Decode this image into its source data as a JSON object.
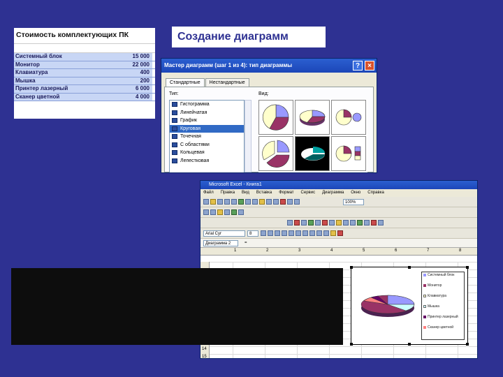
{
  "slide_title": "Создание диаграмм",
  "price_table": {
    "title": "Стоимость комплектующих ПК",
    "rows": [
      {
        "name": "Системный блок",
        "value": "15 000"
      },
      {
        "name": "Монитор",
        "value": "22 000"
      },
      {
        "name": "Клавиатура",
        "value": "400"
      },
      {
        "name": "Мышка",
        "value": "200"
      },
      {
        "name": "Принтер лазерный",
        "value": "6 000"
      },
      {
        "name": "Сканер цветной",
        "value": "4 000"
      }
    ]
  },
  "wizard": {
    "title": "Мастер диаграмм (шаг 1 из 4): тип диаграммы",
    "help": "?",
    "close": "×",
    "tabs": [
      "Стандартные",
      "Нестандартные"
    ],
    "type_label": "Тип:",
    "view_label": "Вид:",
    "types": [
      "Гистограмма",
      "Линейчатая",
      "График",
      "Круговая",
      "Точечная",
      "С областями",
      "Кольцевая",
      "Лепестковая"
    ],
    "selected_type": "Круговая"
  },
  "excel": {
    "title": "Microsoft Excel - Книга1",
    "menu": [
      "Файл",
      "Правка",
      "Вид",
      "Вставка",
      "Формат",
      "Сервис",
      "Диаграмма",
      "Окно",
      "Справка"
    ],
    "font_name": "Arial Cyr",
    "font_size": "8",
    "zoom": "100%",
    "name_box": "Диаграмма 2",
    "columns": [
      "1",
      "2",
      "3",
      "4",
      "5",
      "6",
      "7",
      "8"
    ],
    "rows": [
      "14",
      "15"
    ],
    "legend": [
      "Системный блок",
      "Монитор",
      "Клавиатура",
      "Мышка",
      "Принтер лазерный",
      "Сканер цветной"
    ]
  },
  "colors": {
    "background": "#2e3192",
    "pie": [
      "#9999ff",
      "#993366",
      "#ffffcc",
      "#ccffff",
      "#660066",
      "#ff8080"
    ]
  }
}
